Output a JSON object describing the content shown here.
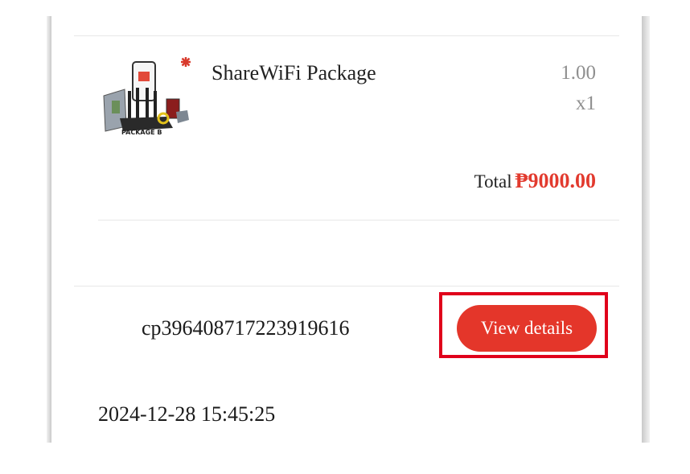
{
  "order": {
    "product": {
      "name": "ShareWiFi Package",
      "price": "1.00",
      "quantity": "x1",
      "thumbnail_icon": "package-b-image",
      "thumbnail_caption": "PACKAGE B"
    },
    "total_label": "Total",
    "total_amount": "₱9000.00",
    "order_id": "cp396408717223919616",
    "view_details_label": "View details",
    "date": "2024-12-28 15:45:25"
  },
  "colors": {
    "accent": "#e4362a",
    "total_text": "#e23a2e",
    "highlight": "#e0001b",
    "muted_text": "#8f8f8f"
  }
}
